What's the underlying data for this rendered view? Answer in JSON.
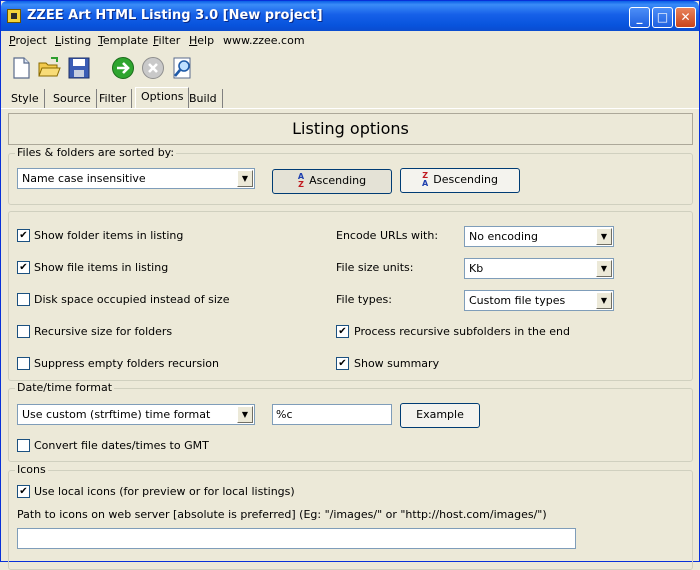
{
  "window": {
    "title": "ZZEE Art HTML Listing 3.0 [New project]",
    "minimize": "_",
    "maximize": "□",
    "close": "✕"
  },
  "menu": {
    "items": [
      {
        "underlined": "P",
        "rest": "roject"
      },
      {
        "underlined": "L",
        "rest": "isting"
      },
      {
        "underlined": "T",
        "rest": "emplate"
      },
      {
        "underlined": "F",
        "rest": "ilter"
      },
      {
        "underlined": "H",
        "rest": "elp"
      }
    ],
    "link": "www.zzee.com"
  },
  "toolbar": {
    "icons": [
      "new-file-icon",
      "open-folder-icon",
      "save-disk-icon",
      "go-arrow-icon",
      "stop-icon",
      "preview-icon"
    ]
  },
  "tabs": [
    "Style",
    "Source",
    "Filter",
    "Options",
    "Build"
  ],
  "active_tab": "Options",
  "heading": "Listing options",
  "sort": {
    "group_title": "Files & folders are sorted by:",
    "selected": "Name case insensitive",
    "ascending": "Ascending",
    "descending": "Descending"
  },
  "options": {
    "left": [
      {
        "label": "Show folder items in listing",
        "checked": true
      },
      {
        "label": "Show file items in listing",
        "checked": true
      },
      {
        "label": "Disk space occupied instead of size",
        "checked": false
      },
      {
        "label": "Recursive size for folders",
        "checked": false
      },
      {
        "label": "Suppress empty folders recursion",
        "checked": false
      }
    ],
    "encode_label": "Encode URLs with:",
    "encode_value": "No encoding",
    "size_label": "File size units:",
    "size_value": "Kb",
    "types_label": "File types:",
    "types_value": "Custom file types",
    "process_recursive": {
      "label": "Process recursive subfolders in the end",
      "checked": true
    },
    "show_summary": {
      "label": "Show summary",
      "checked": true
    }
  },
  "datetime": {
    "group_title": "Date/time format",
    "format_selected": "Use custom (strftime) time format",
    "format_string": "%c",
    "example_button": "Example",
    "gmt_label": "Convert file dates/times to GMT",
    "gmt_checked": false
  },
  "icons_group": {
    "group_title": "Icons",
    "local_icons_label": "Use local icons (for preview or for local listings)",
    "local_icons_checked": true,
    "path_label": "Path to icons on web server [absolute is preferred] (Eg: \"/images/\" or \"http://host.com/images/\")",
    "path_value": ""
  }
}
